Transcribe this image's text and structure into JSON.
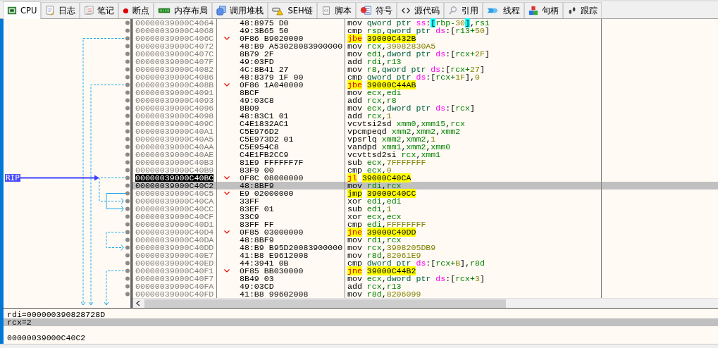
{
  "tabs": [
    {
      "label": "CPU",
      "selected": true
    },
    {
      "label": "日志",
      "selected": false
    },
    {
      "label": "笔记",
      "selected": false
    },
    {
      "label": "断点",
      "selected": false
    },
    {
      "label": "内存布局",
      "selected": false
    },
    {
      "label": "调用堆栈",
      "selected": false
    },
    {
      "label": "SEH链",
      "selected": false
    },
    {
      "label": "脚本",
      "selected": false
    },
    {
      "label": "符号",
      "selected": false
    },
    {
      "label": "源代码",
      "selected": false
    },
    {
      "label": "引用",
      "selected": false
    },
    {
      "label": "线程",
      "selected": false
    },
    {
      "label": "句柄",
      "selected": false
    },
    {
      "label": "跟踪",
      "selected": false
    }
  ],
  "rip_label": "RIP",
  "disassembly": {
    "rows": [
      {
        "address": "00000039000C4064",
        "bytes": "48:8975 D0",
        "branch": false,
        "current": false,
        "selected": false,
        "instruction": [
          {
            "kind": "op",
            "text": "mov "
          },
          {
            "kind": "size",
            "text": "qword ptr "
          },
          {
            "kind": "seg",
            "text": "ss"
          },
          {
            "kind": "sym",
            "text": ":"
          },
          {
            "kind": "brace",
            "text": "["
          },
          {
            "kind": "reg",
            "text": "rbp-"
          },
          {
            "kind": "num",
            "text": "30"
          },
          {
            "kind": "brace",
            "text": "]"
          },
          {
            "kind": "sym",
            "text": ","
          },
          {
            "kind": "reg",
            "text": "rsi"
          }
        ]
      },
      {
        "address": "00000039000C4068",
        "bytes": "49:3B65 50",
        "branch": false,
        "current": false,
        "selected": false,
        "instruction": [
          {
            "kind": "op",
            "text": "cmp "
          },
          {
            "kind": "reg",
            "text": "rsp"
          },
          {
            "kind": "sym",
            "text": ","
          },
          {
            "kind": "size",
            "text": "qword ptr "
          },
          {
            "kind": "seg",
            "text": "ds"
          },
          {
            "kind": "sym",
            "text": ":["
          },
          {
            "kind": "reg",
            "text": "r13+"
          },
          {
            "kind": "num",
            "text": "50"
          },
          {
            "kind": "sym",
            "text": "]"
          }
        ]
      },
      {
        "address": "00000039000C406C",
        "bytes": "0F86 B9020000",
        "branch": true,
        "current": false,
        "selected": false,
        "instruction": [
          {
            "kind": "jcc",
            "text": "jbe "
          },
          {
            "kind": "target",
            "text": "39000C432B"
          }
        ]
      },
      {
        "address": "00000039000C4072",
        "bytes": "48:B9 A53028083900000",
        "branch": false,
        "current": false,
        "selected": false,
        "instruction": [
          {
            "kind": "op",
            "text": "mov "
          },
          {
            "kind": "reg",
            "text": "rcx"
          },
          {
            "kind": "sym",
            "text": ","
          },
          {
            "kind": "num",
            "text": "39082830A5"
          }
        ]
      },
      {
        "address": "00000039000C407C",
        "bytes": "8B79 2F",
        "branch": false,
        "current": false,
        "selected": false,
        "instruction": [
          {
            "kind": "op",
            "text": "mov "
          },
          {
            "kind": "reg",
            "text": "edi"
          },
          {
            "kind": "sym",
            "text": ","
          },
          {
            "kind": "size",
            "text": "dword ptr "
          },
          {
            "kind": "seg",
            "text": "ds"
          },
          {
            "kind": "sym",
            "text": ":["
          },
          {
            "kind": "reg",
            "text": "rcx+"
          },
          {
            "kind": "num",
            "text": "2F"
          },
          {
            "kind": "sym",
            "text": "]"
          }
        ]
      },
      {
        "address": "00000039000C407F",
        "bytes": "49:03FD",
        "branch": false,
        "current": false,
        "selected": false,
        "instruction": [
          {
            "kind": "op",
            "text": "add "
          },
          {
            "kind": "reg",
            "text": "rdi"
          },
          {
            "kind": "sym",
            "text": ","
          },
          {
            "kind": "reg",
            "text": "r13"
          }
        ]
      },
      {
        "address": "00000039000C4082",
        "bytes": "4C:8B41 27",
        "branch": false,
        "current": false,
        "selected": false,
        "instruction": [
          {
            "kind": "op",
            "text": "mov "
          },
          {
            "kind": "reg",
            "text": "r8"
          },
          {
            "kind": "sym",
            "text": ","
          },
          {
            "kind": "size",
            "text": "qword ptr "
          },
          {
            "kind": "seg",
            "text": "ds"
          },
          {
            "kind": "sym",
            "text": ":["
          },
          {
            "kind": "reg",
            "text": "rcx+"
          },
          {
            "kind": "num",
            "text": "27"
          },
          {
            "kind": "sym",
            "text": "]"
          }
        ]
      },
      {
        "address": "00000039000C4086",
        "bytes": "48:8379 1F 00",
        "branch": false,
        "current": false,
        "selected": false,
        "instruction": [
          {
            "kind": "op",
            "text": "cmp "
          },
          {
            "kind": "size",
            "text": "qword ptr "
          },
          {
            "kind": "seg",
            "text": "ds"
          },
          {
            "kind": "sym",
            "text": ":["
          },
          {
            "kind": "reg",
            "text": "rcx+"
          },
          {
            "kind": "num",
            "text": "1F"
          },
          {
            "kind": "sym",
            "text": "],"
          },
          {
            "kind": "num",
            "text": "0"
          }
        ]
      },
      {
        "address": "00000039000C408B",
        "bytes": "0F86 1A040000",
        "branch": true,
        "current": false,
        "selected": false,
        "instruction": [
          {
            "kind": "jcc",
            "text": "jbe "
          },
          {
            "kind": "target",
            "text": "39000C44AB"
          }
        ]
      },
      {
        "address": "00000039000C4091",
        "bytes": "8BCF",
        "branch": false,
        "current": false,
        "selected": false,
        "instruction": [
          {
            "kind": "op",
            "text": "mov "
          },
          {
            "kind": "reg",
            "text": "ecx"
          },
          {
            "kind": "sym",
            "text": ","
          },
          {
            "kind": "reg",
            "text": "edi"
          }
        ]
      },
      {
        "address": "00000039000C4093",
        "bytes": "49:03C8",
        "branch": false,
        "current": false,
        "selected": false,
        "instruction": [
          {
            "kind": "op",
            "text": "add "
          },
          {
            "kind": "reg",
            "text": "rcx"
          },
          {
            "kind": "sym",
            "text": ","
          },
          {
            "kind": "reg",
            "text": "r8"
          }
        ]
      },
      {
        "address": "00000039000C4096",
        "bytes": "8B09",
        "branch": false,
        "current": false,
        "selected": false,
        "instruction": [
          {
            "kind": "op",
            "text": "mov "
          },
          {
            "kind": "reg",
            "text": "ecx"
          },
          {
            "kind": "sym",
            "text": ","
          },
          {
            "kind": "size",
            "text": "dword ptr "
          },
          {
            "kind": "seg",
            "text": "ds"
          },
          {
            "kind": "sym",
            "text": ":["
          },
          {
            "kind": "reg",
            "text": "rcx"
          },
          {
            "kind": "sym",
            "text": "]"
          }
        ]
      },
      {
        "address": "00000039000C4098",
        "bytes": "48:83C1 01",
        "branch": false,
        "current": false,
        "selected": false,
        "instruction": [
          {
            "kind": "op",
            "text": "add "
          },
          {
            "kind": "reg",
            "text": "rcx"
          },
          {
            "kind": "sym",
            "text": ","
          },
          {
            "kind": "num",
            "text": "1"
          }
        ]
      },
      {
        "address": "00000039000C409C",
        "bytes": "C4E1832AC1",
        "branch": false,
        "current": false,
        "selected": false,
        "instruction": [
          {
            "kind": "op",
            "text": "vcvtsi2sd "
          },
          {
            "kind": "reg",
            "text": "xmm0"
          },
          {
            "kind": "sym",
            "text": ","
          },
          {
            "kind": "reg",
            "text": "xmm15"
          },
          {
            "kind": "sym",
            "text": ","
          },
          {
            "kind": "reg",
            "text": "rcx"
          }
        ]
      },
      {
        "address": "00000039000C40A1",
        "bytes": "C5E976D2",
        "branch": false,
        "current": false,
        "selected": false,
        "instruction": [
          {
            "kind": "op",
            "text": "vpcmpeqd "
          },
          {
            "kind": "reg",
            "text": "xmm2"
          },
          {
            "kind": "sym",
            "text": ","
          },
          {
            "kind": "reg",
            "text": "xmm2"
          },
          {
            "kind": "sym",
            "text": ","
          },
          {
            "kind": "reg",
            "text": "xmm2"
          }
        ]
      },
      {
        "address": "00000039000C40A5",
        "bytes": "C5E973D2 01",
        "branch": false,
        "current": false,
        "selected": false,
        "instruction": [
          {
            "kind": "op",
            "text": "vpsrlq "
          },
          {
            "kind": "reg",
            "text": "xmm2"
          },
          {
            "kind": "sym",
            "text": ","
          },
          {
            "kind": "reg",
            "text": "xmm2"
          },
          {
            "kind": "sym",
            "text": ","
          },
          {
            "kind": "num",
            "text": "1"
          }
        ]
      },
      {
        "address": "00000039000C40AA",
        "bytes": "C5E954C8",
        "branch": false,
        "current": false,
        "selected": false,
        "instruction": [
          {
            "kind": "op",
            "text": "vandpd "
          },
          {
            "kind": "reg",
            "text": "xmm1"
          },
          {
            "kind": "sym",
            "text": ","
          },
          {
            "kind": "reg",
            "text": "xmm2"
          },
          {
            "kind": "sym",
            "text": ","
          },
          {
            "kind": "reg",
            "text": "xmm0"
          }
        ]
      },
      {
        "address": "00000039000C40AE",
        "bytes": "C4E1FB2CC9",
        "branch": false,
        "current": false,
        "selected": false,
        "instruction": [
          {
            "kind": "op",
            "text": "vcvttsd2si "
          },
          {
            "kind": "reg",
            "text": "rcx"
          },
          {
            "kind": "sym",
            "text": ","
          },
          {
            "kind": "reg",
            "text": "xmm1"
          }
        ]
      },
      {
        "address": "00000039000C40B3",
        "bytes": "81E9 FFFFFF7F",
        "branch": false,
        "current": false,
        "selected": false,
        "instruction": [
          {
            "kind": "op",
            "text": "sub "
          },
          {
            "kind": "reg",
            "text": "ecx"
          },
          {
            "kind": "sym",
            "text": ","
          },
          {
            "kind": "num",
            "text": "7FFFFFFF"
          }
        ]
      },
      {
        "address": "00000039000C40B9",
        "bytes": "83F9 00",
        "branch": false,
        "current": false,
        "selected": false,
        "instruction": [
          {
            "kind": "op",
            "text": "cmp "
          },
          {
            "kind": "reg",
            "text": "ecx"
          },
          {
            "kind": "sym",
            "text": ","
          },
          {
            "kind": "num",
            "text": "0"
          }
        ]
      },
      {
        "address": "00000039000C40BC",
        "bytes": "0F8C 08000000",
        "branch": true,
        "current": true,
        "selected": false,
        "instruction": [
          {
            "kind": "jcc",
            "text": "jl "
          },
          {
            "kind": "target",
            "text": "39000C40CA"
          }
        ]
      },
      {
        "address": "00000039000C40C2",
        "bytes": "48:8BF9",
        "branch": false,
        "current": false,
        "selected": true,
        "instruction": [
          {
            "kind": "op",
            "text": "mov "
          },
          {
            "kind": "reg",
            "text": "rdi"
          },
          {
            "kind": "sym",
            "text": ","
          },
          {
            "kind": "reg",
            "text": "rcx"
          }
        ]
      },
      {
        "address": "00000039000C40C5",
        "bytes": "E9 02000000",
        "branch": true,
        "current": false,
        "selected": false,
        "instruction": [
          {
            "kind": "jmp",
            "text": "jmp "
          },
          {
            "kind": "target",
            "text": "39000C40CC"
          }
        ]
      },
      {
        "address": "00000039000C40CA",
        "bytes": "33FF",
        "branch": false,
        "current": false,
        "selected": false,
        "instruction": [
          {
            "kind": "op",
            "text": "xor "
          },
          {
            "kind": "reg",
            "text": "edi"
          },
          {
            "kind": "sym",
            "text": ","
          },
          {
            "kind": "reg",
            "text": "edi"
          }
        ]
      },
      {
        "address": "00000039000C40CC",
        "bytes": "83EF 01",
        "branch": false,
        "current": false,
        "selected": false,
        "instruction": [
          {
            "kind": "op",
            "text": "sub "
          },
          {
            "kind": "reg",
            "text": "edi"
          },
          {
            "kind": "sym",
            "text": ","
          },
          {
            "kind": "num",
            "text": "1"
          }
        ]
      },
      {
        "address": "00000039000C40CF",
        "bytes": "33C9",
        "branch": false,
        "current": false,
        "selected": false,
        "instruction": [
          {
            "kind": "op",
            "text": "xor "
          },
          {
            "kind": "reg",
            "text": "ecx"
          },
          {
            "kind": "sym",
            "text": ","
          },
          {
            "kind": "reg",
            "text": "ecx"
          }
        ]
      },
      {
        "address": "00000039000C40D1",
        "bytes": "83FF FF",
        "branch": false,
        "current": false,
        "selected": false,
        "instruction": [
          {
            "kind": "op",
            "text": "cmp "
          },
          {
            "kind": "reg",
            "text": "edi"
          },
          {
            "kind": "sym",
            "text": ","
          },
          {
            "kind": "num",
            "text": "FFFFFFFF"
          }
        ]
      },
      {
        "address": "00000039000C40D4",
        "bytes": "0F85 03000000",
        "branch": true,
        "current": false,
        "selected": false,
        "instruction": [
          {
            "kind": "jcc",
            "text": "jne "
          },
          {
            "kind": "target",
            "text": "39000C40DD"
          }
        ]
      },
      {
        "address": "00000039000C40DA",
        "bytes": "48:8BF9",
        "branch": false,
        "current": false,
        "selected": false,
        "instruction": [
          {
            "kind": "op",
            "text": "mov "
          },
          {
            "kind": "reg",
            "text": "rdi"
          },
          {
            "kind": "sym",
            "text": ","
          },
          {
            "kind": "reg",
            "text": "rcx"
          }
        ]
      },
      {
        "address": "00000039000C40DD",
        "bytes": "48:B9 B95D20083900000",
        "branch": false,
        "current": false,
        "selected": false,
        "instruction": [
          {
            "kind": "op",
            "text": "mov "
          },
          {
            "kind": "reg",
            "text": "rcx"
          },
          {
            "kind": "sym",
            "text": ","
          },
          {
            "kind": "num",
            "text": "3908205DB9"
          }
        ]
      },
      {
        "address": "00000039000C40E7",
        "bytes": "41:B8 E9612008",
        "branch": false,
        "current": false,
        "selected": false,
        "instruction": [
          {
            "kind": "op",
            "text": "mov "
          },
          {
            "kind": "reg",
            "text": "r8d"
          },
          {
            "kind": "sym",
            "text": ","
          },
          {
            "kind": "num",
            "text": "82061E9"
          }
        ]
      },
      {
        "address": "00000039000C40ED",
        "bytes": "44:3941 0B",
        "branch": false,
        "current": false,
        "selected": false,
        "instruction": [
          {
            "kind": "op",
            "text": "cmp "
          },
          {
            "kind": "size",
            "text": "dword ptr "
          },
          {
            "kind": "seg",
            "text": "ds"
          },
          {
            "kind": "sym",
            "text": ":["
          },
          {
            "kind": "reg",
            "text": "rcx+"
          },
          {
            "kind": "num",
            "text": "B"
          },
          {
            "kind": "sym",
            "text": "],"
          },
          {
            "kind": "reg",
            "text": "r8d"
          }
        ]
      },
      {
        "address": "00000039000C40F1",
        "bytes": "0F85 BB030000",
        "branch": true,
        "current": false,
        "selected": false,
        "instruction": [
          {
            "kind": "jcc",
            "text": "jne "
          },
          {
            "kind": "target",
            "text": "39000C44B2"
          }
        ]
      },
      {
        "address": "00000039000C40F7",
        "bytes": "8B49 03",
        "branch": false,
        "current": false,
        "selected": false,
        "instruction": [
          {
            "kind": "op",
            "text": "mov "
          },
          {
            "kind": "reg",
            "text": "ecx"
          },
          {
            "kind": "sym",
            "text": ","
          },
          {
            "kind": "size",
            "text": "dword ptr "
          },
          {
            "kind": "seg",
            "text": "ds"
          },
          {
            "kind": "sym",
            "text": ":["
          },
          {
            "kind": "reg",
            "text": "rcx+"
          },
          {
            "kind": "num",
            "text": "3"
          },
          {
            "kind": "sym",
            "text": "]"
          }
        ]
      },
      {
        "address": "00000039000C40FA",
        "bytes": "49:03CD",
        "branch": false,
        "current": false,
        "selected": false,
        "instruction": [
          {
            "kind": "op",
            "text": "add "
          },
          {
            "kind": "reg",
            "text": "rcx"
          },
          {
            "kind": "sym",
            "text": ","
          },
          {
            "kind": "reg",
            "text": "r13"
          }
        ]
      },
      {
        "address": "00000039000C40FD",
        "bytes": "41:B8 99602008",
        "branch": false,
        "current": false,
        "selected": false,
        "instruction": [
          {
            "kind": "op",
            "text": "mov "
          },
          {
            "kind": "reg",
            "text": "r8d"
          },
          {
            "kind": "sym",
            "text": ","
          },
          {
            "kind": "num",
            "text": "8206099"
          }
        ]
      }
    ]
  },
  "info_panel": {
    "lines": [
      {
        "text": "rdi=000000390828728D",
        "selected": false
      },
      {
        "text": "rcx=2",
        "selected": true
      }
    ],
    "address": "00000039000C40C2"
  }
}
